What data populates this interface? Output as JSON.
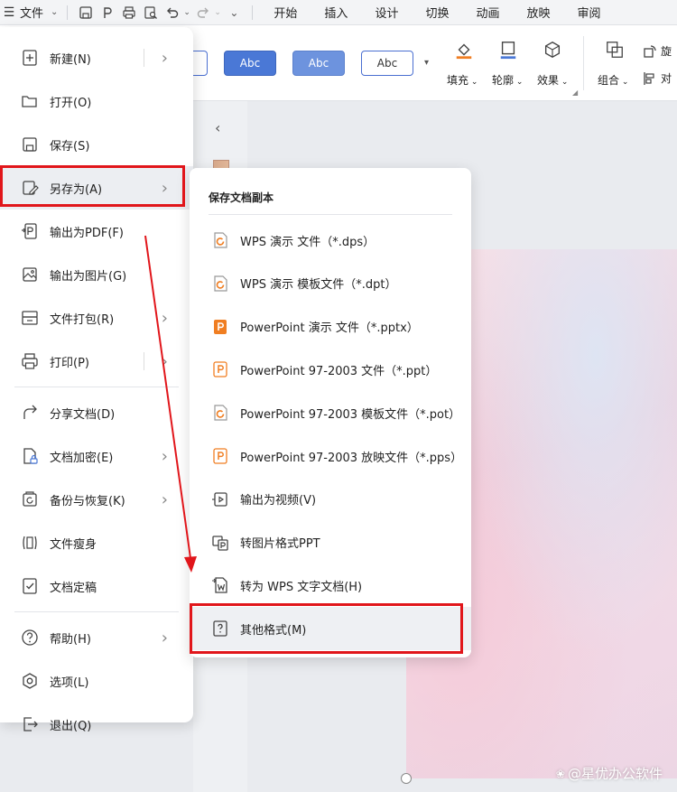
{
  "menubar": {
    "file_label": "文件",
    "tabs": [
      "开始",
      "插入",
      "设计",
      "切换",
      "动画",
      "放映",
      "审阅"
    ]
  },
  "ribbon": {
    "style_labels": [
      "Abc",
      "Abc",
      "Abc"
    ],
    "buttons": [
      {
        "label": "填充",
        "icon": "fill-bucket-icon"
      },
      {
        "label": "轮廓",
        "icon": "outline-icon"
      },
      {
        "label": "效果",
        "icon": "effect-cube-icon"
      },
      {
        "label": "组合",
        "icon": "group-icon"
      },
      {
        "label": "旋",
        "icon": "rotate-icon"
      },
      {
        "label": "对",
        "icon": "align-icon"
      }
    ]
  },
  "file_menu": {
    "items": [
      {
        "label": "新建(N)",
        "icon": "new-file-icon",
        "chevron": true,
        "bar": true
      },
      {
        "label": "打开(O)",
        "icon": "folder-open-icon",
        "chevron": false
      },
      {
        "label": "保存(S)",
        "icon": "save-icon",
        "chevron": false
      },
      {
        "label": "另存为(A)",
        "icon": "save-as-icon",
        "chevron": true,
        "active": true
      },
      {
        "label": "输出为PDF(F)",
        "icon": "pdf-export-icon",
        "chevron": false
      },
      {
        "label": "输出为图片(G)",
        "icon": "image-export-icon",
        "chevron": false
      },
      {
        "label": "文件打包(R)",
        "icon": "package-icon",
        "chevron": true
      },
      {
        "label": "打印(P)",
        "icon": "print-icon",
        "chevron": true,
        "bar": true
      },
      {
        "label": "分享文档(D)",
        "icon": "share-icon",
        "chevron": false
      },
      {
        "label": "文档加密(E)",
        "icon": "lock-file-icon",
        "chevron": true
      },
      {
        "label": "备份与恢复(K)",
        "icon": "backup-icon",
        "chevron": true
      },
      {
        "label": "文件瘦身",
        "icon": "slim-file-icon",
        "chevron": false
      },
      {
        "label": "文档定稿",
        "icon": "finalize-icon",
        "chevron": false
      },
      {
        "label": "帮助(H)",
        "icon": "help-icon",
        "chevron": true
      },
      {
        "label": "选项(L)",
        "icon": "options-icon",
        "chevron": false
      },
      {
        "label": "退出(Q)",
        "icon": "exit-icon",
        "chevron": false
      }
    ]
  },
  "submenu": {
    "title": "保存文档副本",
    "items": [
      {
        "label": "WPS 演示 文件（*.dps）",
        "icon": "wps-dps-icon"
      },
      {
        "label": "WPS 演示 模板文件（*.dpt）",
        "icon": "wps-dpt-icon"
      },
      {
        "label": "PowerPoint 演示 文件（*.pptx）",
        "icon": "pptx-icon"
      },
      {
        "label": "PowerPoint 97-2003 文件（*.ppt）",
        "icon": "ppt-icon"
      },
      {
        "label": "PowerPoint 97-2003 模板文件（*.pot）",
        "icon": "pot-icon"
      },
      {
        "label": "PowerPoint 97-2003 放映文件（*.pps）",
        "icon": "pps-icon"
      },
      {
        "label": "输出为视频(V)",
        "icon": "video-export-icon"
      },
      {
        "label": "转图片格式PPT",
        "icon": "image-ppt-icon"
      },
      {
        "label": "转为 WPS 文字文档(H)",
        "icon": "wps-writer-icon"
      },
      {
        "label": "其他格式(M)",
        "icon": "other-format-icon",
        "active": true
      }
    ]
  },
  "watermark": "@星优办公软件",
  "colors": {
    "highlight_red": "#e1161b",
    "accent_orange": "#f07e22",
    "accent_blue": "#4a78d6"
  }
}
